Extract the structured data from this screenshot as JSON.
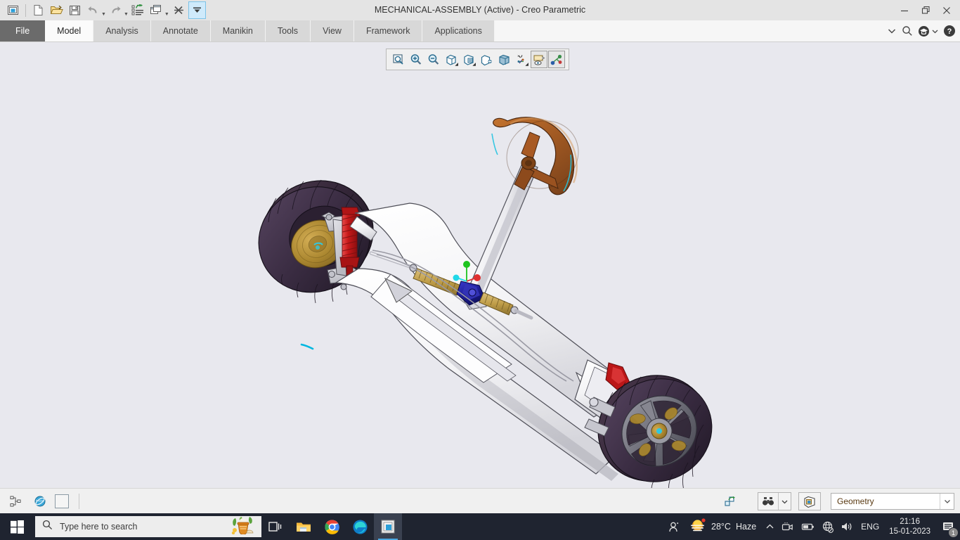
{
  "window": {
    "title": "MECHANICAL-ASSEMBLY (Active) - Creo Parametric",
    "minimize_label": "Minimize",
    "restore_label": "Restore Down",
    "close_label": "Close"
  },
  "quick_access": {
    "items": [
      {
        "name": "new-window-icon",
        "label": "New Window"
      },
      {
        "name": "new-file-icon",
        "label": "New"
      },
      {
        "name": "open-folder-icon",
        "label": "Open"
      },
      {
        "name": "save-icon",
        "label": "Save"
      },
      {
        "name": "undo-icon",
        "label": "Undo"
      },
      {
        "name": "redo-icon",
        "label": "Redo"
      },
      {
        "name": "regenerate-icon",
        "label": "Regenerate"
      },
      {
        "name": "window-switch-icon",
        "label": "Window"
      },
      {
        "name": "close-window-icon",
        "label": "Close"
      },
      {
        "name": "customize-qat-icon",
        "label": "Customize Quick Access Toolbar"
      }
    ]
  },
  "ribbon": {
    "tabs": [
      {
        "label": "File",
        "active": false,
        "kind": "file"
      },
      {
        "label": "Model",
        "active": true,
        "kind": "normal"
      },
      {
        "label": "Analysis",
        "active": false,
        "kind": "normal"
      },
      {
        "label": "Annotate",
        "active": false,
        "kind": "normal"
      },
      {
        "label": "Manikin",
        "active": false,
        "kind": "normal"
      },
      {
        "label": "Tools",
        "active": false,
        "kind": "normal"
      },
      {
        "label": "View",
        "active": false,
        "kind": "normal"
      },
      {
        "label": "Framework",
        "active": false,
        "kind": "normal"
      },
      {
        "label": "Applications",
        "active": false,
        "kind": "normal"
      }
    ],
    "right_icons": [
      {
        "name": "chevron-down-icon",
        "label": "Minimize the Ribbon"
      },
      {
        "name": "search-icon",
        "label": "Search"
      },
      {
        "name": "learning-connector-icon",
        "label": "Learning Connector"
      },
      {
        "name": "help-icon",
        "label": "Help"
      }
    ]
  },
  "view_toolbar": {
    "buttons": [
      {
        "name": "zoom-to-fit-icon",
        "label": "Refit"
      },
      {
        "name": "zoom-in-icon",
        "label": "Zoom In"
      },
      {
        "name": "zoom-out-icon",
        "label": "Zoom Out"
      },
      {
        "name": "saved-orientations-icon",
        "label": "Saved Orientations"
      },
      {
        "name": "view-manager-icon",
        "label": "View Manager"
      },
      {
        "name": "appearance-gallery-icon",
        "label": "Appearance Gallery"
      },
      {
        "name": "display-style-icon",
        "label": "Display Style"
      },
      {
        "name": "datum-display-filters-icon",
        "label": "Datum Display Filters"
      },
      {
        "name": "annotation-display-icon",
        "label": "Annotation Display"
      },
      {
        "name": "spin-center-icon",
        "label": "Spin Center"
      }
    ]
  },
  "model": {
    "name": "MECHANICAL-ASSEMBLY",
    "description": "Go-kart / lightweight vehicle chassis assembly shown in shaded-with-edges display style",
    "background_color": "#e8e8ee",
    "components": [
      {
        "name": "front-wheel",
        "color": "#3b2d3c"
      },
      {
        "name": "front-brake-disc",
        "color": "#a8862f"
      },
      {
        "name": "front-coilover-spring",
        "color": "#c41f20"
      },
      {
        "name": "chassis-frame",
        "color": "#f5f5f7"
      },
      {
        "name": "steering-wheel",
        "color": "#a85a24"
      },
      {
        "name": "steering-column",
        "color": "#e9e9ec"
      },
      {
        "name": "steering-rack",
        "color": "#c9a44c"
      },
      {
        "name": "rack-housing",
        "color": "#1e1f8c"
      },
      {
        "name": "rear-wheel-rim",
        "color": "#6a6a72"
      },
      {
        "name": "rear-tire",
        "color": "#3b2d3c"
      },
      {
        "name": "rear-brake-caliper",
        "color": "#c41f20"
      },
      {
        "name": "cyan-datum-curve",
        "color": "#00b7e0"
      }
    ],
    "coordinate_triad": {
      "x_axis_color": "#e03030",
      "y_axis_color": "#1fc41f",
      "z_axis_color": "#20d8e8"
    }
  },
  "status_bar": {
    "left_icons": [
      {
        "name": "model-tree-icon",
        "label": "Model Tree"
      },
      {
        "name": "browser-icon",
        "label": "Web Browser"
      },
      {
        "name": "layer-tree-icon",
        "label": "Layer Tree"
      }
    ],
    "right_icons": [
      {
        "name": "regenerate-status-icon",
        "label": "Regeneration Status"
      },
      {
        "name": "search-binoculars-icon",
        "label": "Search"
      },
      {
        "name": "search-dropdown-icon",
        "label": "Search Options"
      },
      {
        "name": "annotation-orientation-icon",
        "label": "Annotation Orientation"
      }
    ],
    "filter": {
      "label": "Selection Filter",
      "value": "Geometry",
      "dropdown_icon": "chevron-down-icon"
    }
  },
  "taskbar": {
    "start_label": "Start",
    "search_placeholder": "Type here to search",
    "search_icon": "search-icon",
    "doodle_icon": "pongal-festival-icon",
    "apps": [
      {
        "name": "task-view-icon",
        "label": "Task View",
        "active": false
      },
      {
        "name": "file-explorer-icon",
        "label": "File Explorer",
        "active": false
      },
      {
        "name": "chrome-icon",
        "label": "Google Chrome",
        "active": false
      },
      {
        "name": "edge-icon",
        "label": "Microsoft Edge",
        "active": false
      },
      {
        "name": "creo-parametric-icon",
        "label": "Creo Parametric",
        "active": true
      }
    ],
    "tray": {
      "people_icon": "people-icon",
      "weather_icon": "haze-sun-icon",
      "weather_temp": "28°C",
      "weather_condition": "Haze",
      "overflow_icon": "chevron-up-icon",
      "icons": [
        {
          "name": "camera-icon",
          "label": "Camera"
        },
        {
          "name": "battery-icon",
          "label": "Battery"
        },
        {
          "name": "network-disconnected-icon",
          "label": "Network"
        },
        {
          "name": "volume-icon",
          "label": "Volume"
        }
      ],
      "language": "ENG",
      "time": "21:16",
      "date": "15-01-2023",
      "notification_icon": "notification-icon",
      "notification_count": "1"
    }
  }
}
